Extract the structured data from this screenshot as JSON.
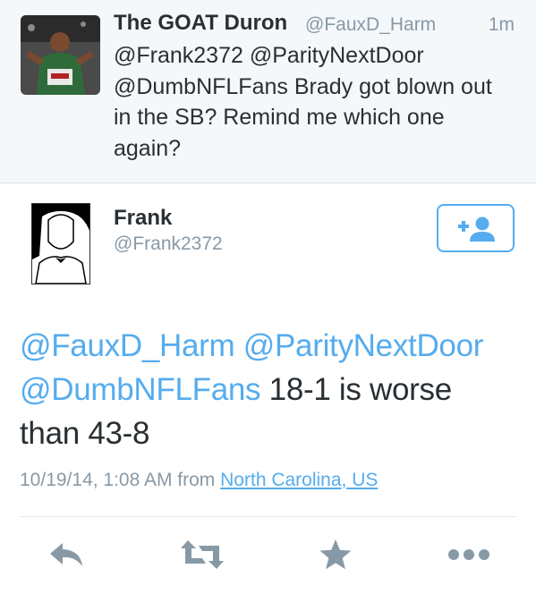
{
  "parent_tweet": {
    "name": "The GOAT Duron",
    "handle": "@FauxD_Harm",
    "time": "1m",
    "text_lines": [
      "@Frank2372 @ParityNextDoor",
      "@DumbNFLFans Brady got blown out",
      "in the SB? Remind me which one",
      "again?"
    ]
  },
  "tweet": {
    "author_name": "Frank",
    "author_handle": "@Frank2372",
    "mentions": {
      "m1": "@FauxD_Harm",
      "m2": "@ParityNextDoor",
      "m3": "@DumbNFLFans"
    },
    "body_1": " 18-1 is worse",
    "body_2": "than 43-8",
    "timestamp": "10/19/14, 1:08 AM from ",
    "location": "North Carolina, US"
  },
  "actions": [
    {
      "icon": "reply-icon"
    },
    {
      "icon": "retweet-icon"
    },
    {
      "icon": "favorite-icon"
    },
    {
      "icon": "more-icon"
    }
  ],
  "colors": {
    "accent": "#55acee",
    "text": "#292f33",
    "muted": "#8899a6",
    "icon": "#8899a6",
    "parent_bg": "#f5f8fa"
  }
}
